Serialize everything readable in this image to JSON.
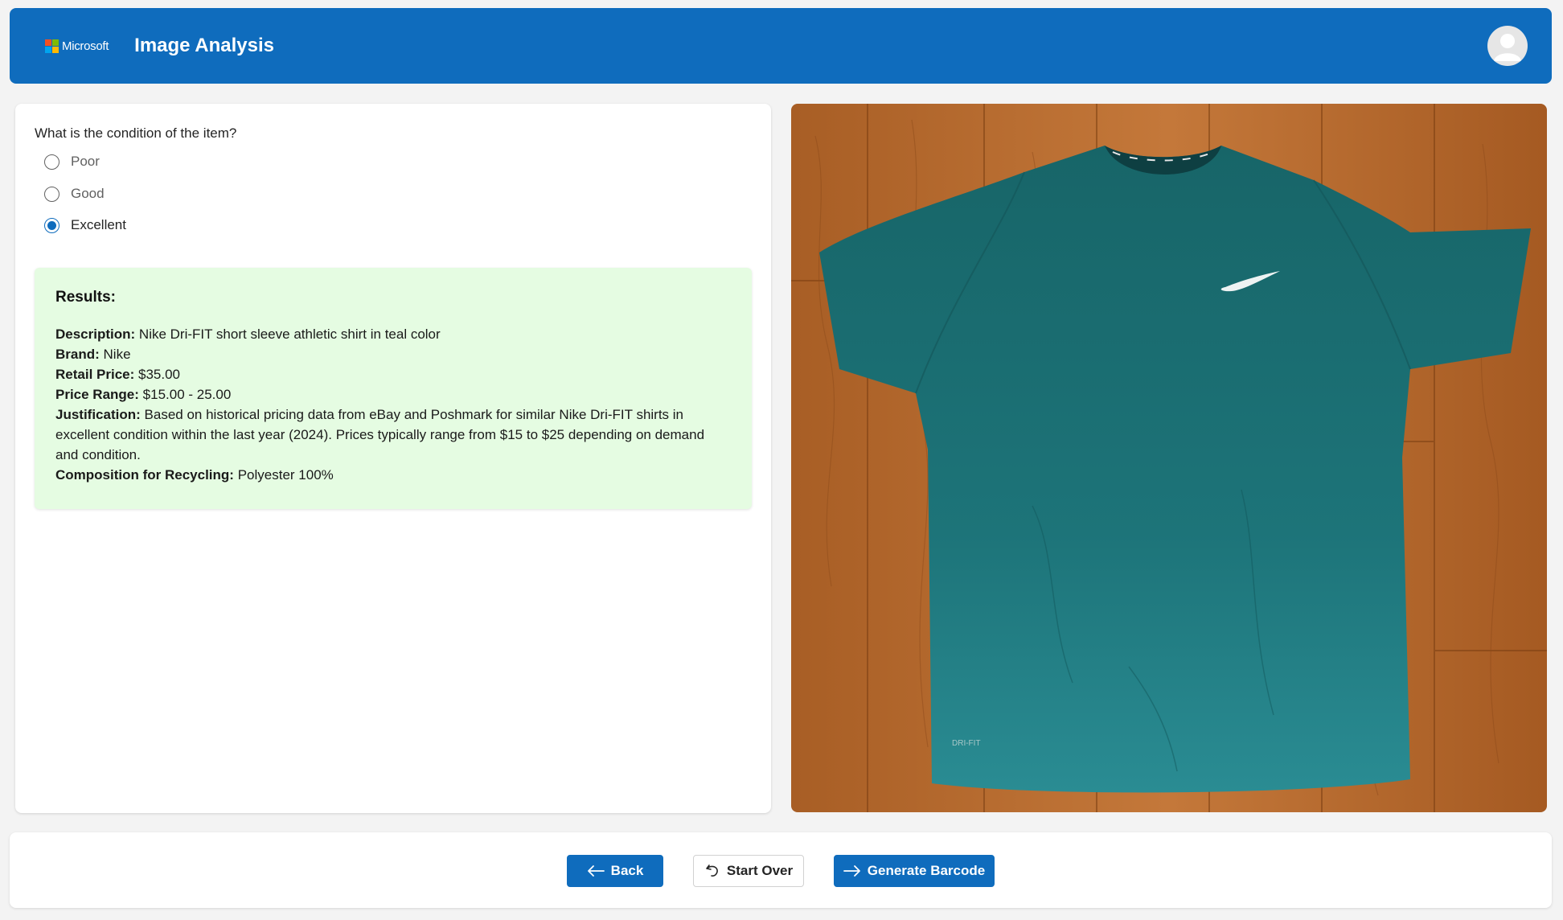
{
  "header": {
    "brand": "Microsoft",
    "title": "Image Analysis",
    "brand_colors": [
      "#f25022",
      "#7fba00",
      "#00a4ef",
      "#ffb900"
    ]
  },
  "form": {
    "question": "What is the condition of the item?",
    "options": [
      {
        "label": "Poor",
        "selected": false
      },
      {
        "label": "Good",
        "selected": false
      },
      {
        "label": "Excellent",
        "selected": true
      }
    ]
  },
  "results": {
    "title": "Results:",
    "description_label": "Description:",
    "description": "Nike Dri-FIT short sleeve athletic shirt in teal color",
    "brand_label": "Brand:",
    "brand": "Nike",
    "retail_price_label": "Retail Price:",
    "retail_price": "$35.00",
    "price_range_label": "Price Range:",
    "price_range": "$15.00 - 25.00",
    "justification_label": "Justification:",
    "justification": "Based on historical pricing data from eBay and Poshmark for similar Nike Dri-FIT shirts in excellent condition within the last year (2024). Prices typically range from $15 to $25 depending on demand and condition.",
    "composition_label": "Composition for Recycling:",
    "composition": "Polyester 100%"
  },
  "footer": {
    "back_label": "Back",
    "start_over_label": "Start Over",
    "generate_barcode_label": "Generate Barcode"
  },
  "colors": {
    "accent": "#0f6cbd",
    "results_bg": "#e5fce2",
    "shirt": "#1d6f73",
    "wood": "#b86a2c"
  }
}
